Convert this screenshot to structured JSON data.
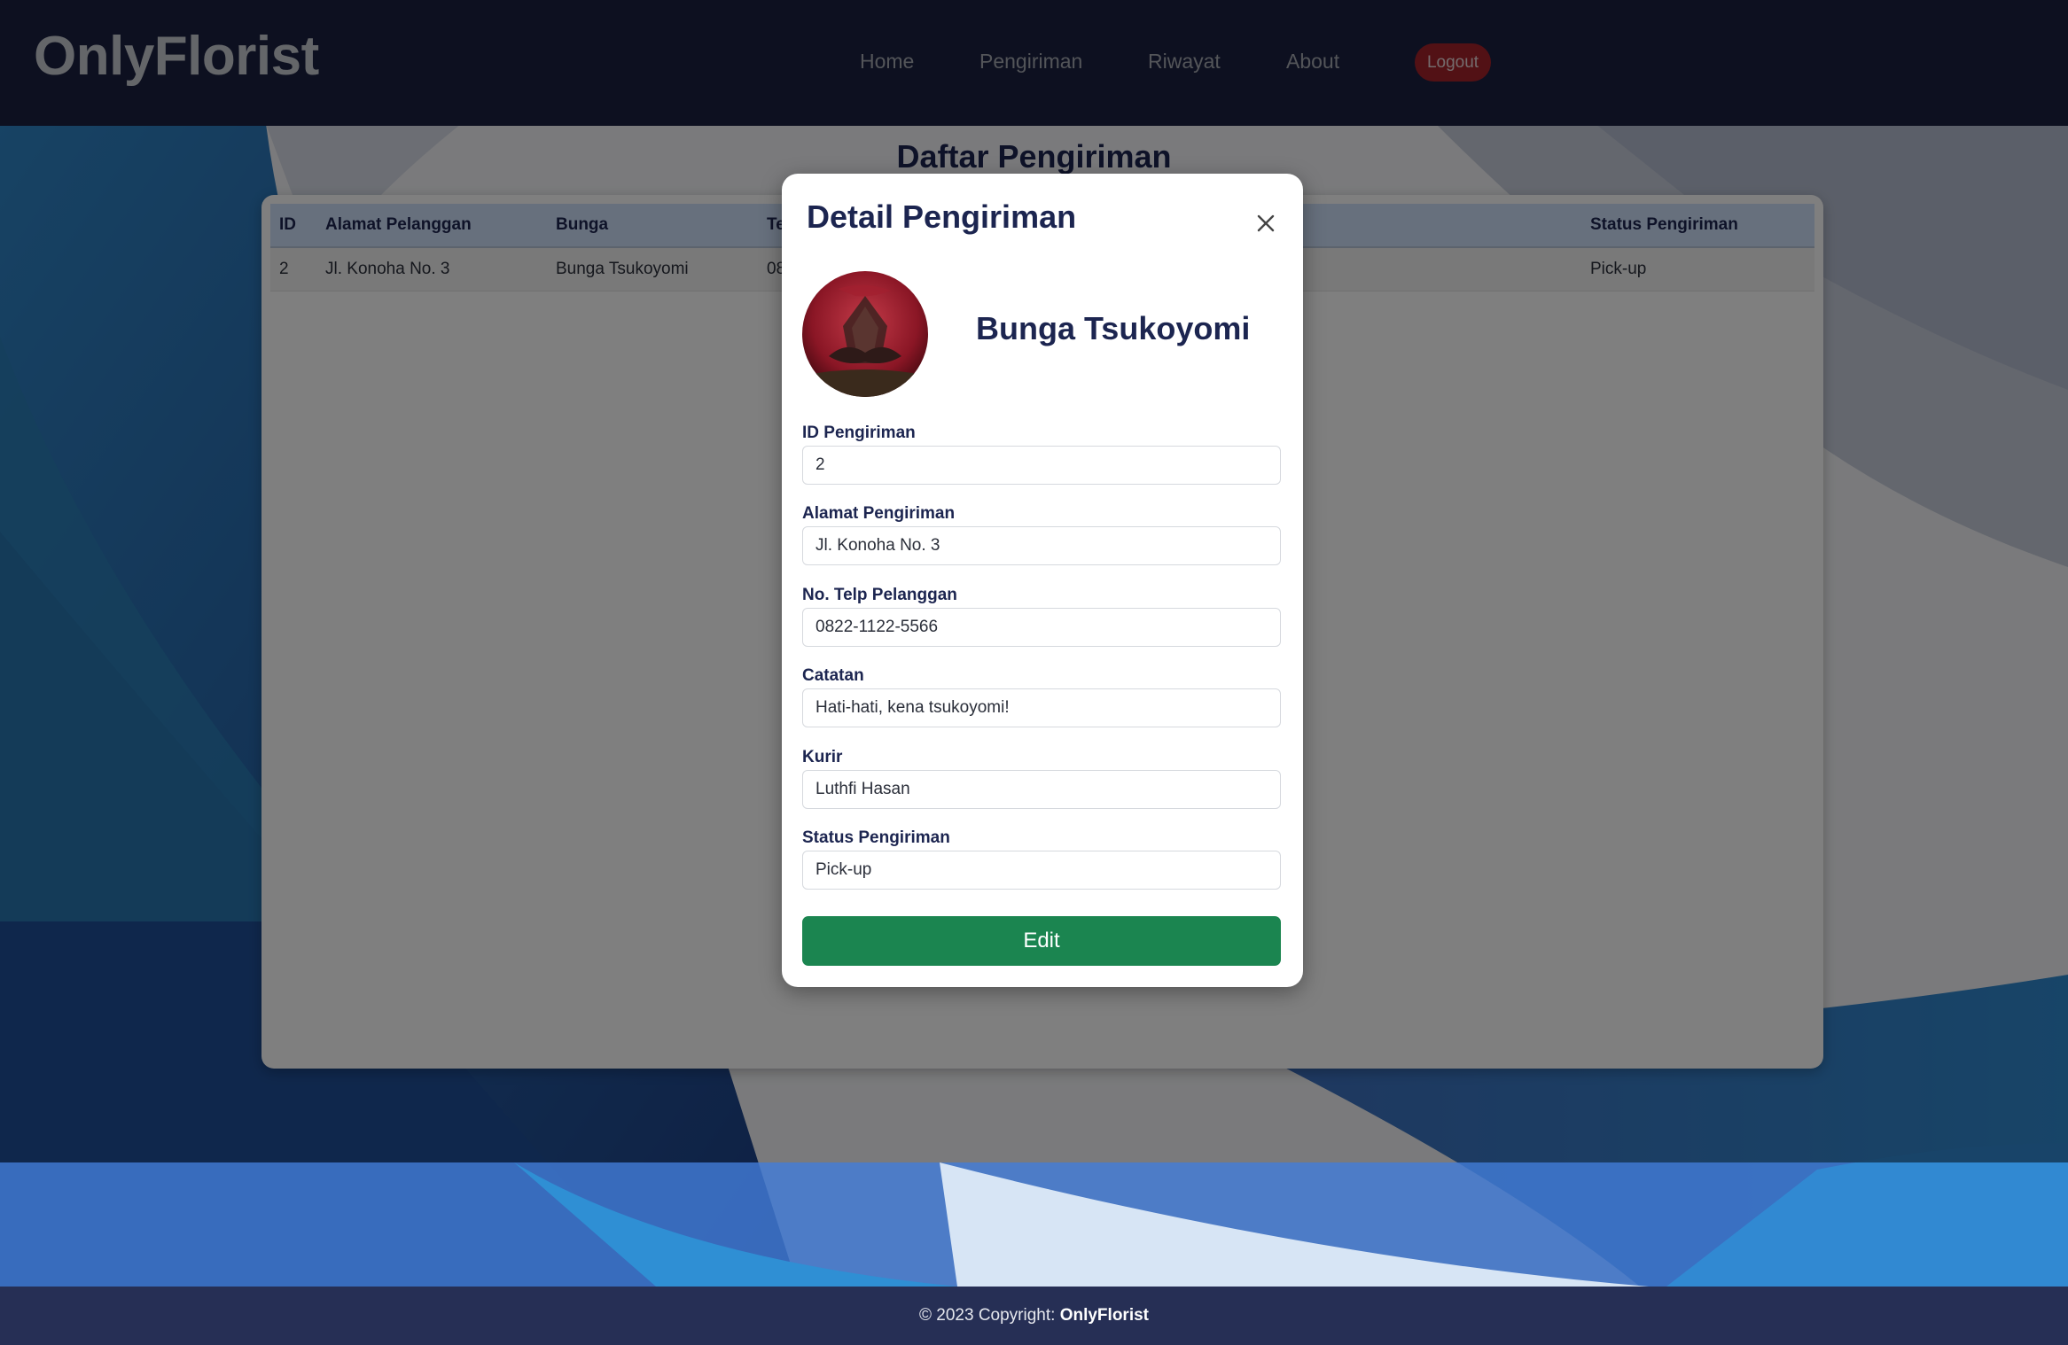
{
  "navbar": {
    "brand": "OnlyFlorist",
    "links": [
      "Home",
      "Pengiriman",
      "Riwayat",
      "About"
    ],
    "logout_label": "Logout"
  },
  "page": {
    "title": "Daftar Pengiriman",
    "table": {
      "headers": [
        "ID",
        "Alamat Pelanggan",
        "Bunga",
        "Te",
        "Status Pengiriman"
      ],
      "rows": [
        [
          "2",
          "Jl. Konoha No. 3",
          "Bunga Tsukoyomi",
          "08",
          "Pick-up"
        ]
      ]
    }
  },
  "modal": {
    "title": "Detail Pengiriman",
    "flower_name": "Bunga Tsukoyomi",
    "fields": [
      {
        "label": "ID Pengiriman",
        "value": "2"
      },
      {
        "label": "Alamat Pengiriman",
        "value": "Jl. Konoha No. 3"
      },
      {
        "label": "No. Telp Pelanggan",
        "value": "0822-1122-5566"
      },
      {
        "label": "Catatan",
        "value": "Hati-hati, kena tsukoyomi!"
      },
      {
        "label": "Kurir",
        "value": "Luthfi Hasan"
      },
      {
        "label": "Status Pengiriman",
        "value": "Pick-up"
      }
    ],
    "edit_label": "Edit"
  },
  "footer": {
    "prefix": "© 2023 Copyright: ",
    "brand": "OnlyFlorist"
  },
  "colors": {
    "navbar": "#1a2140",
    "logout": "#a5222b",
    "edit_button": "#1b8550",
    "title_text": "#1c2550",
    "footer": "#262f55"
  },
  "icons": {
    "close": "close-icon",
    "avatar": "flower-avatar-image"
  }
}
